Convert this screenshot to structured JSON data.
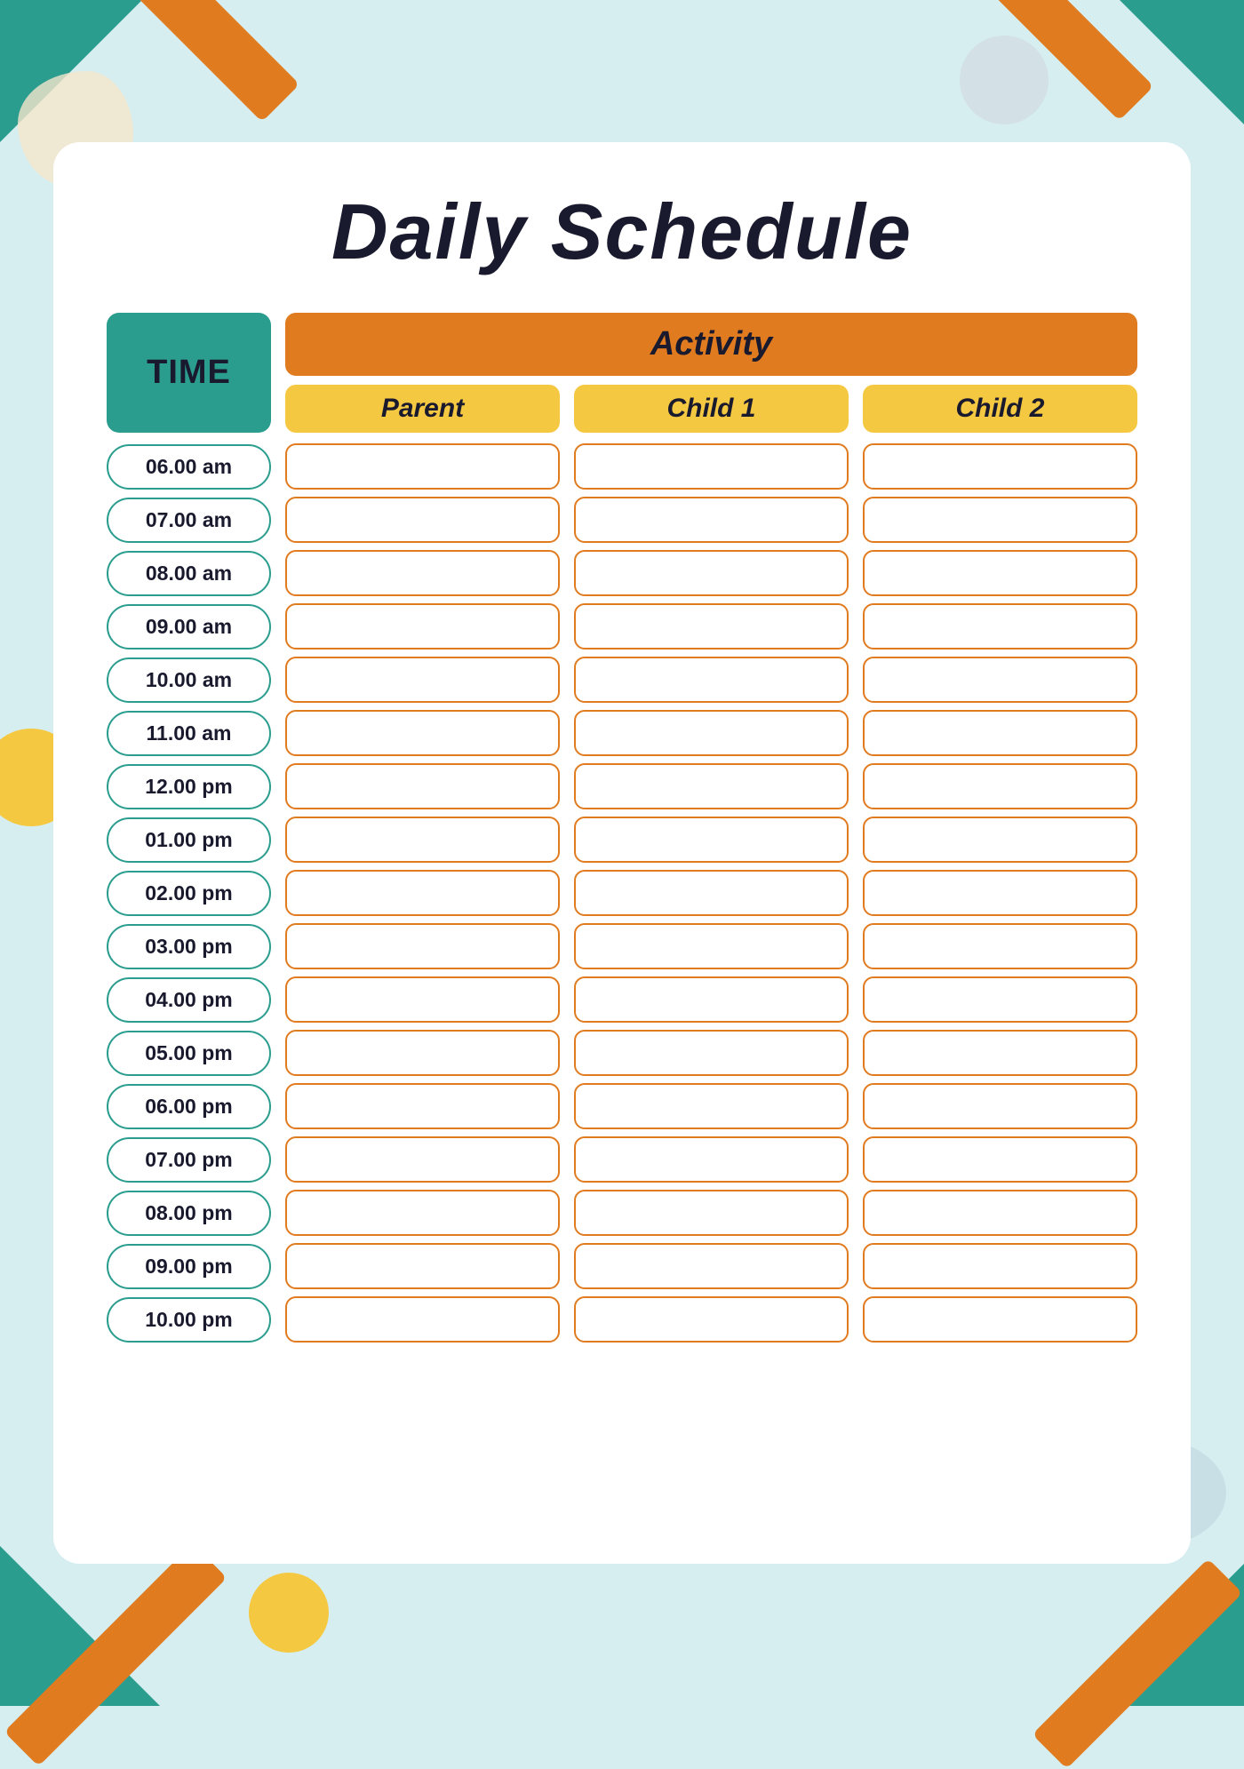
{
  "page": {
    "title": "Daily Schedule",
    "background_color": "#d6eef0"
  },
  "header": {
    "time_label": "TIME",
    "activity_label": "Activity",
    "columns": [
      {
        "id": "parent",
        "label": "Parent"
      },
      {
        "id": "child1",
        "label": "Child 1"
      },
      {
        "id": "child2",
        "label": "Child 2"
      }
    ]
  },
  "time_slots": [
    "06.00 am",
    "07.00 am",
    "08.00 am",
    "09.00 am",
    "10.00 am",
    "11.00 am",
    "12.00 pm",
    "01.00 pm",
    "02.00 pm",
    "03.00 pm",
    "04.00 pm",
    "05.00 pm",
    "06.00 pm",
    "07.00 pm",
    "08.00 pm",
    "09.00 pm",
    "10.00 pm"
  ]
}
